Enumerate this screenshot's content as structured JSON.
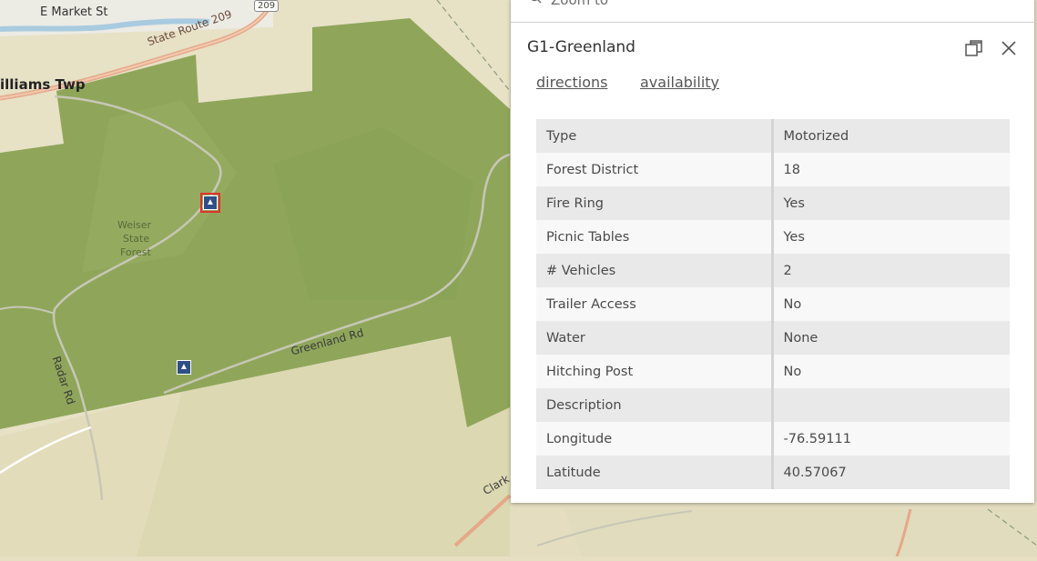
{
  "map": {
    "labels": {
      "street_e_market": "E Market St",
      "route_shield": "209",
      "state_route": "State Route 209",
      "township": "illiams Twp",
      "forest_line1": "Weiser",
      "forest_line2": "State",
      "forest_line3": "Forest",
      "greenland_rd": "Greenland Rd",
      "radar_rd": "Radar Rd",
      "clark_rd": "Clark"
    },
    "icons": [
      "campground-icon",
      "campground-icon"
    ],
    "colors": {
      "base": "#e6dfc2",
      "forest": "#8fa65a",
      "road_primary": "#e8b08a",
      "road_minor": "#ffffff"
    }
  },
  "popup": {
    "search_placeholder": "Zoom to",
    "title": "G1-Greenland",
    "actions": {
      "directions": "directions",
      "availability": "availability"
    },
    "rows": [
      {
        "key": "Type",
        "value": "Motorized"
      },
      {
        "key": "Forest District",
        "value": "18"
      },
      {
        "key": "Fire Ring",
        "value": "Yes"
      },
      {
        "key": "Picnic Tables",
        "value": "Yes"
      },
      {
        "key": "# Vehicles",
        "value": "2"
      },
      {
        "key": "Trailer Access",
        "value": "No"
      },
      {
        "key": "Water",
        "value": "None"
      },
      {
        "key": "Hitching Post",
        "value": "No"
      },
      {
        "key": "Description",
        "value": ""
      },
      {
        "key": "Longitude",
        "value": "-76.59111"
      },
      {
        "key": "Latitude",
        "value": "40.57067"
      }
    ]
  }
}
